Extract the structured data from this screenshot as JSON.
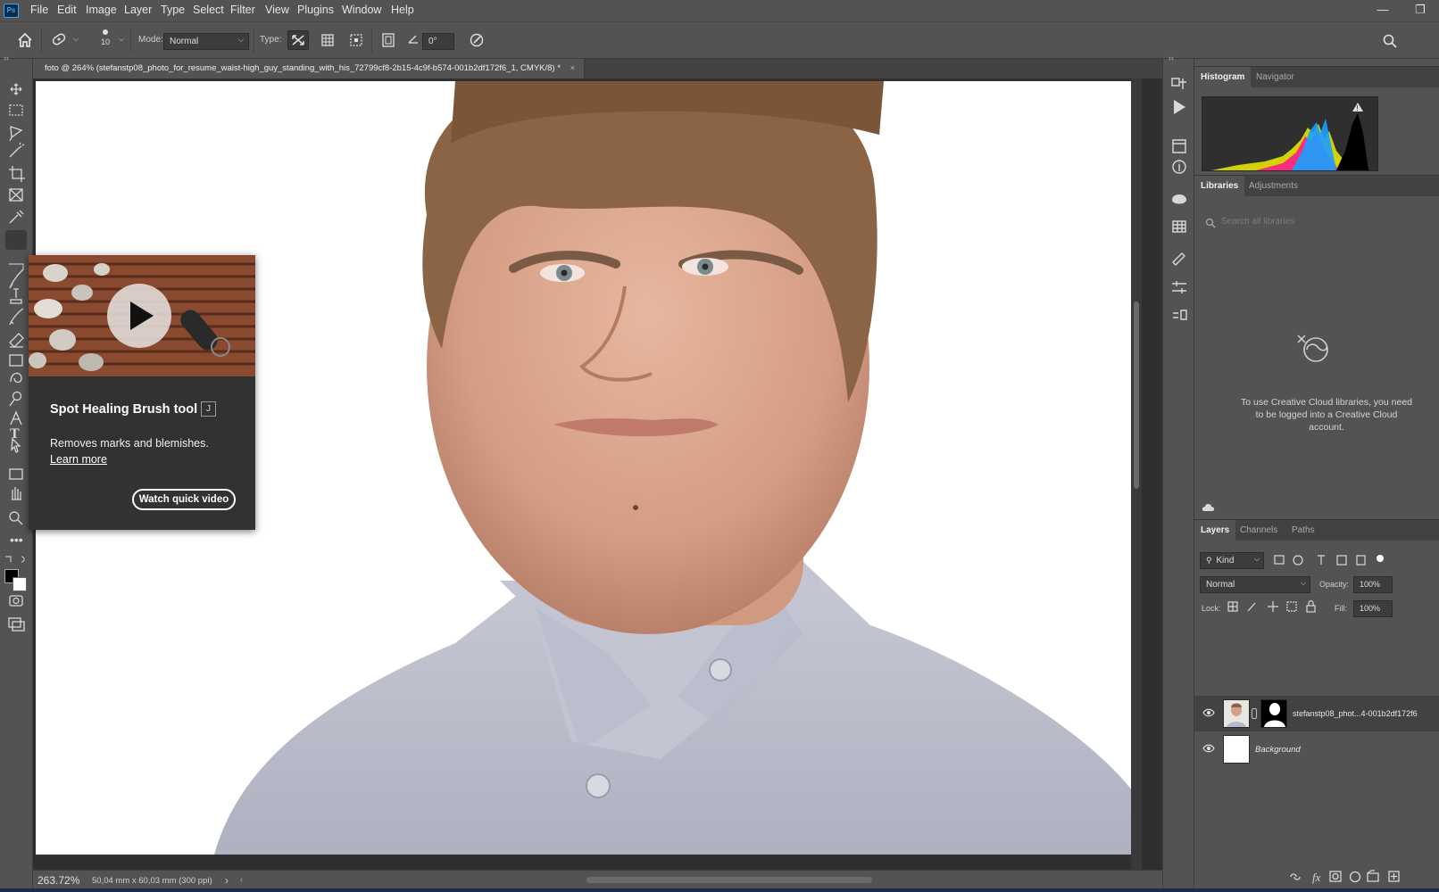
{
  "menubar": {
    "logo": "Ps",
    "items": [
      "File",
      "Edit",
      "Image",
      "Layer",
      "Type",
      "Select",
      "Filter",
      "View",
      "Plugins",
      "Window",
      "Help"
    ],
    "minimize": "—",
    "restore": "❐"
  },
  "options": {
    "brush_size": "10",
    "mode_label": "Mode:",
    "mode_value": "Normal",
    "type_label": "Type:",
    "angle_value": "0°"
  },
  "document": {
    "tab_title": "foto @ 264% (stefanstp08_photo_for_resume_waist-high_guy_standing_with_his_72799cf8-2b15-4c9f-b574-001b2df172f6_1, CMYK/8) *",
    "tab_close": "×"
  },
  "status": {
    "zoom": "263.72%",
    "doc_size": "50,04 mm x 60,03 mm (300 ppi)",
    "arrow": "›"
  },
  "tooltip": {
    "title": "Spot Healing Brush tool",
    "shortcut": "J",
    "description": "Removes marks and blemishes.",
    "link": "Learn more",
    "button": "Watch quick video"
  },
  "panels": {
    "top_tabs": [
      "Histogram",
      "Navigator"
    ],
    "mid_tabs": [
      "Libraries",
      "Adjustments"
    ],
    "library_search_placeholder": "Search all libraries",
    "cc_message": "To use Creative Cloud libraries, you need to be logged into a Creative Cloud account.",
    "layer_tabs": [
      "Layers",
      "Channels",
      "Paths"
    ]
  },
  "layers_panel": {
    "kind_label": "Kind",
    "blend_mode": "Normal",
    "opacity_label": "Opacity:",
    "opacity_value": "100%",
    "lock_label": "Lock:",
    "fill_label": "Fill:",
    "fill_value": "100%",
    "layers": [
      {
        "name": "stefanstp08_phot...4-001b2df172f6"
      },
      {
        "name": "Background"
      }
    ]
  },
  "colors": {
    "ui_bg": "#535353",
    "panel_dark": "#424242",
    "accent_ps": "#31a8ff",
    "foreground_color": "#000000",
    "background_color": "#ffffff"
  }
}
